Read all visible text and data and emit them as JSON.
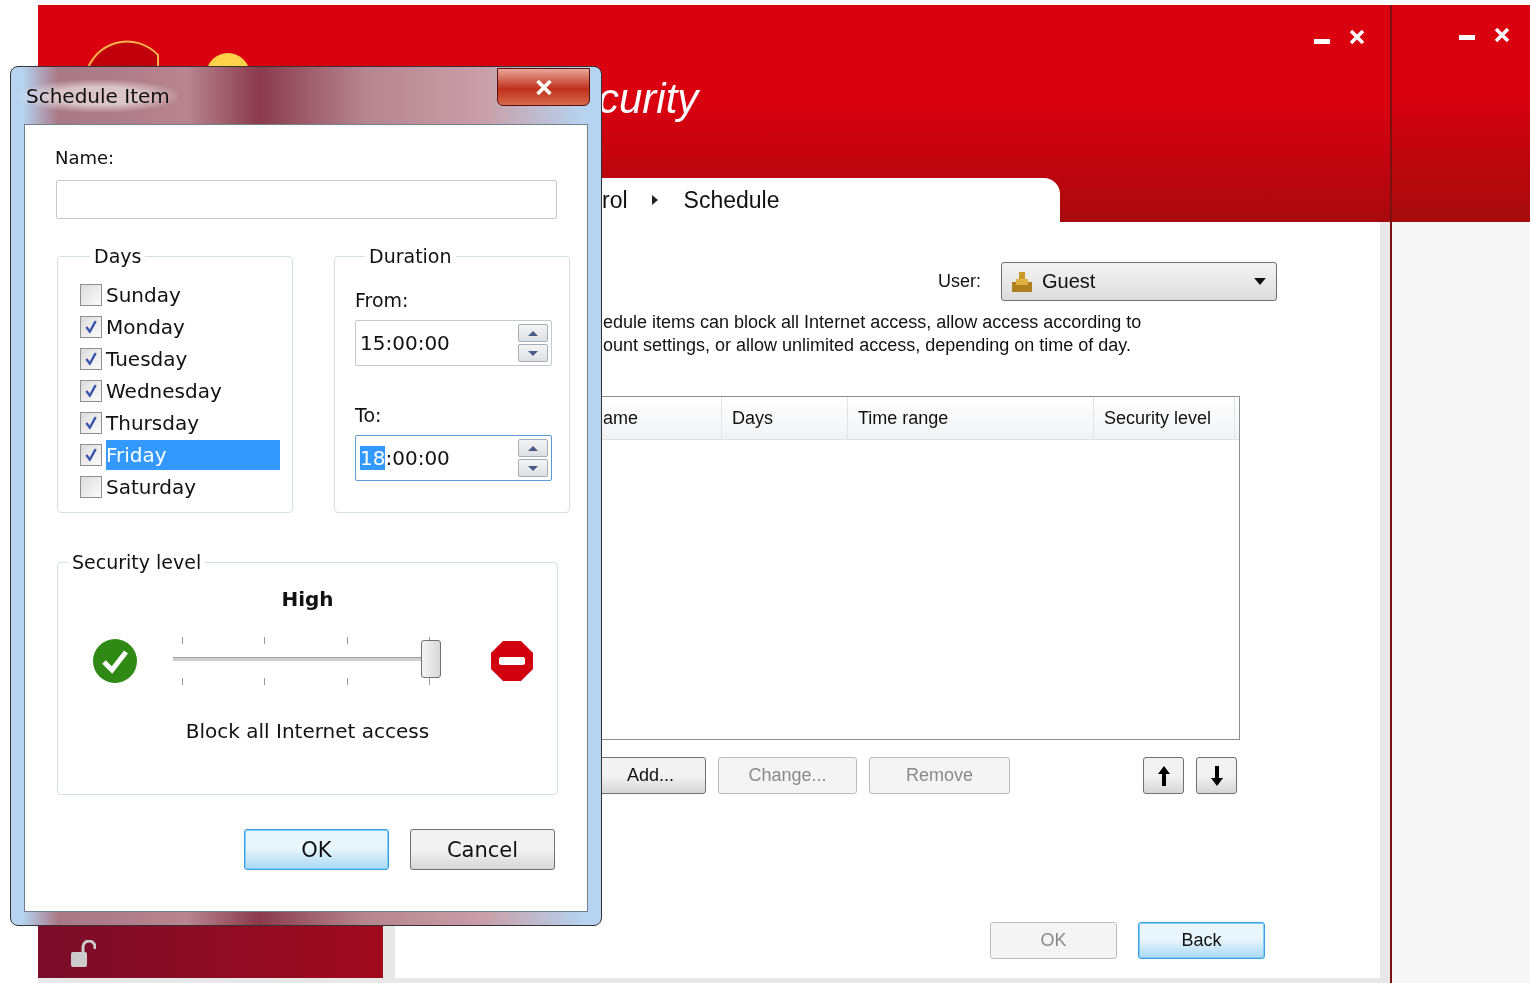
{
  "main_window": {
    "title": "curity",
    "breadcrumb": [
      {
        "label": "rol"
      },
      {
        "label": "Schedule"
      }
    ],
    "user": {
      "label": "User:",
      "value": "Guest"
    },
    "description": "edule items can block all Internet access, allow access according to\nount settings, or allow unlimited access, depending on time of day.",
    "table": {
      "columns": [
        "ame",
        "Days",
        "Time range",
        "Security level"
      ]
    },
    "actions": [
      {
        "label": "Add...",
        "disabled": false
      },
      {
        "label": "Change...",
        "disabled": true
      },
      {
        "label": "Remove",
        "disabled": true
      }
    ],
    "footer_buttons": [
      {
        "label": "OK",
        "disabled": true,
        "default": false
      },
      {
        "label": "Back",
        "disabled": false,
        "default": true
      }
    ]
  },
  "dialog": {
    "title": "Schedule Item",
    "name": {
      "label": "Name:"
    },
    "days": {
      "title": "Days",
      "items": [
        {
          "label": "Sunday",
          "checked": false,
          "selected": false
        },
        {
          "label": "Monday",
          "checked": true,
          "selected": false
        },
        {
          "label": "Tuesday",
          "checked": true,
          "selected": false
        },
        {
          "label": "Wednesday",
          "checked": true,
          "selected": false
        },
        {
          "label": "Thursday",
          "checked": true,
          "selected": false
        },
        {
          "label": "Friday",
          "checked": true,
          "selected": true
        },
        {
          "label": "Saturday",
          "checked": false,
          "selected": false
        }
      ]
    },
    "duration": {
      "title": "Duration",
      "from": {
        "label": "From:",
        "value": "15:00:00"
      },
      "to": {
        "label": "To:",
        "value_selected": "18",
        "value_rest": ":00:00"
      }
    },
    "security": {
      "title": "Security level",
      "level_name": "High",
      "level": 1,
      "description": "Block all Internet access"
    },
    "buttons": [
      {
        "label": "OK",
        "default": true
      },
      {
        "label": "Cancel",
        "default": false
      }
    ]
  }
}
